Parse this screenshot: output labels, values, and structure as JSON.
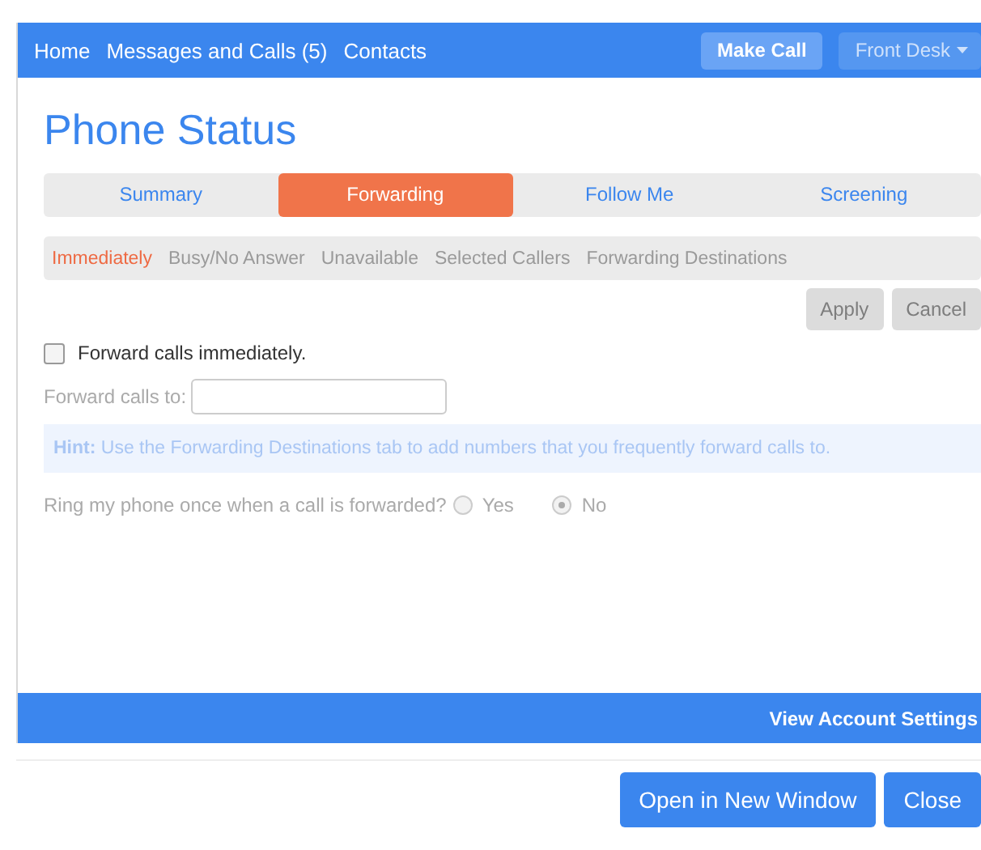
{
  "nav": {
    "links": [
      "Home",
      "Messages and Calls (5)",
      "Contacts"
    ],
    "make_call": {
      "label": "Make Call",
      "disabled": false
    },
    "front_desk": {
      "label": "Front Desk",
      "disabled": true
    }
  },
  "title": "Phone Status",
  "tabs": [
    {
      "label": "Summary",
      "selected": false
    },
    {
      "label": "Forwarding",
      "selected": true
    },
    {
      "label": "Follow Me",
      "selected": false
    },
    {
      "label": "Screening",
      "selected": false
    }
  ],
  "subtabs": [
    {
      "label": "Immediately",
      "selected": true
    },
    {
      "label": "Busy/No Answer",
      "selected": false
    },
    {
      "label": "Unavailable",
      "selected": false
    },
    {
      "label": "Selected Callers",
      "selected": false
    },
    {
      "label": "Forwarding Destinations",
      "selected": false
    }
  ],
  "actions": [
    {
      "label": "Apply",
      "disabled": true
    },
    {
      "label": "Cancel",
      "disabled": true
    }
  ],
  "forward_immediately": {
    "label": "Forward calls immediately.",
    "checked": false
  },
  "forward_to": {
    "label": "Forward calls to:",
    "disabled": true
  },
  "hint": "**Hint:** Use the Forwarding Destinations tab to add numbers that you frequently forward calls to.",
  "ring_once": {
    "label": "Ring my phone once when a call is forwarded?",
    "options": [
      {
        "label": "Yes",
        "selected": false
      },
      {
        "label": "No",
        "selected": true
      }
    ]
  },
  "footer_link": "View Account Settings",
  "buttons": [
    "Open in New Window",
    "Close"
  ]
}
